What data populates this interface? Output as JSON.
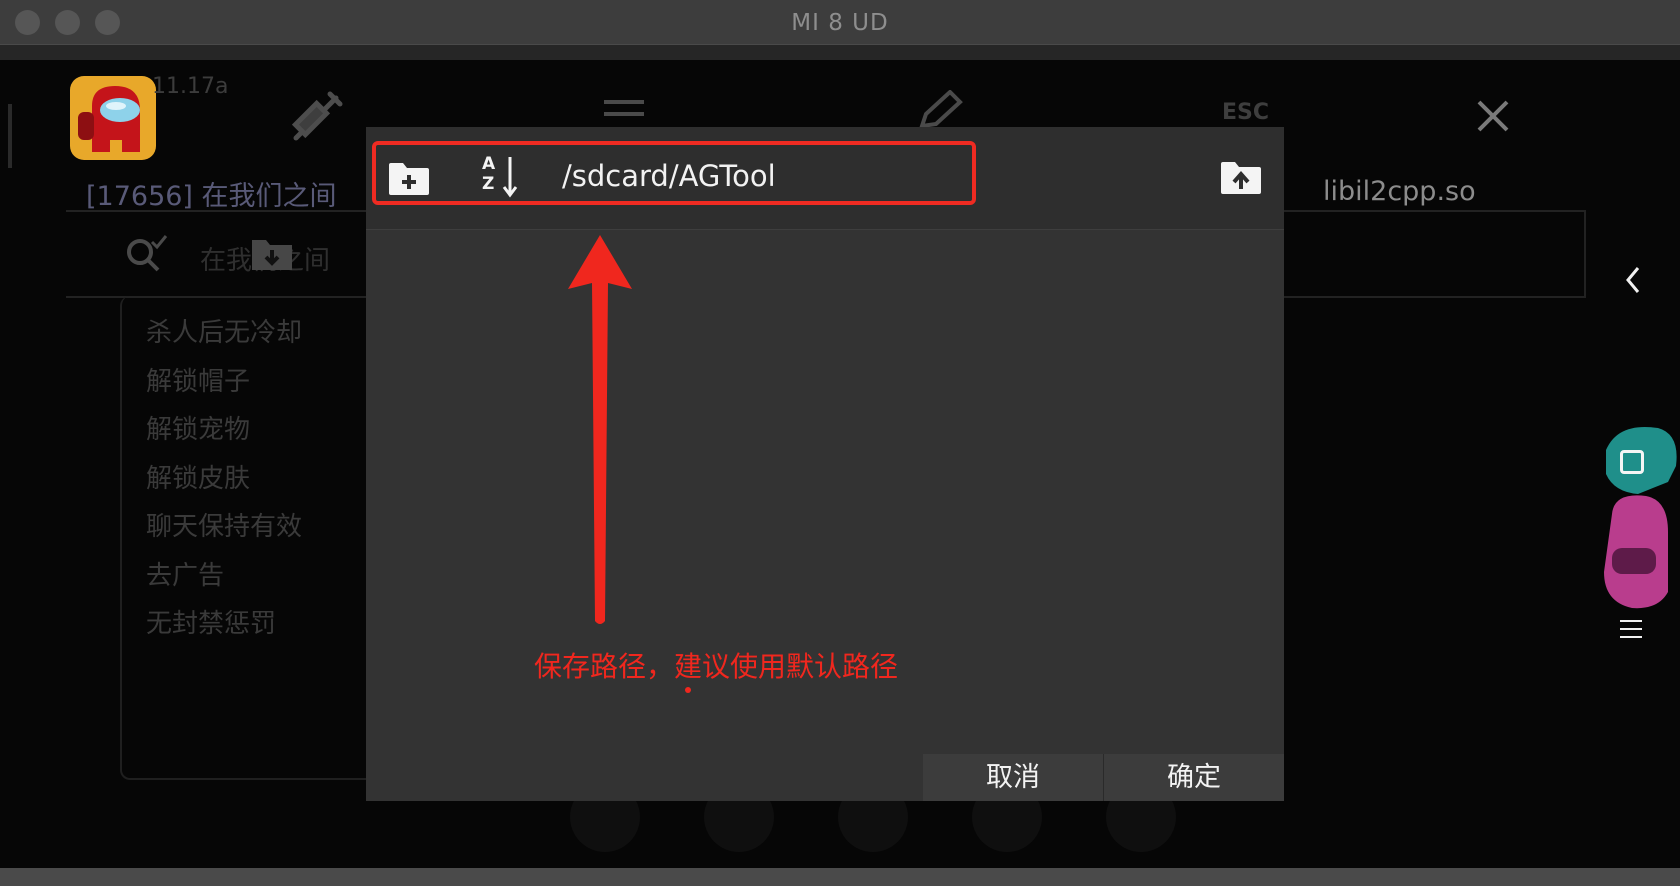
{
  "window": {
    "title": "MI 8 UD"
  },
  "background_app": {
    "version": "11.17a",
    "process_label": "[17656] 在我们之间",
    "library": "libil2cpp.so",
    "esc_label": "ESC",
    "search_placeholder": "在我们之间",
    "menu_items": [
      "杀人后无冷却",
      "解锁帽子",
      "解锁宠物",
      "解锁皮肤",
      "聊天保持有效",
      "去广告",
      "无封禁惩罚"
    ]
  },
  "dialog": {
    "path": "/sdcard/AGTool",
    "annotation": "保存路径，建议使用默认路径",
    "cancel_label": "取消",
    "ok_label": "确定",
    "sort_label_a": "A",
    "sort_label_z": "Z"
  },
  "icons": {
    "new_folder": "new-folder-icon",
    "sort": "sort-az-icon",
    "folder_up": "folder-up-icon",
    "back": "chevron-left-icon",
    "home": "square-home-icon",
    "menu": "hamburger-menu-icon"
  },
  "colors": {
    "annotation_red": "#ef2b22",
    "dialog_bg": "#333333"
  }
}
